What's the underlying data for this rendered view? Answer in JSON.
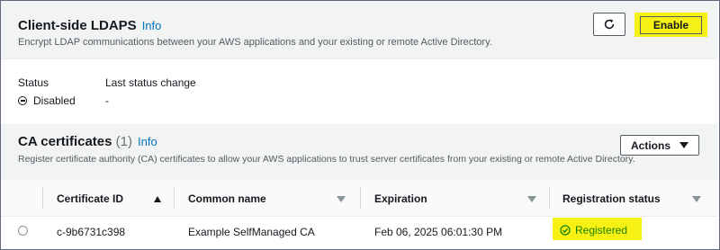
{
  "ldaps": {
    "title": "Client-side LDAPS",
    "info_label": "Info",
    "description": "Encrypt LDAP communications between your AWS applications and your existing or remote Active Directory.",
    "refresh_icon": "refresh-icon",
    "enable_label": "Enable",
    "highlight_color": "#f7f014"
  },
  "status": {
    "status_label": "Status",
    "status_value": "Disabled",
    "status_icon": "disabled-icon",
    "last_change_label": "Last status change",
    "last_change_value": "-"
  },
  "ca": {
    "title": "CA certificates",
    "count": "(1)",
    "info_label": "Info",
    "description": "Register certificate authority (CA) certificates to allow your AWS applications to trust server certificates from your existing or remote Active Directory.",
    "actions_label": "Actions",
    "table": {
      "columns": [
        "Certificate ID",
        "Common name",
        "Expiration",
        "Registration status"
      ],
      "rows": [
        {
          "certificate_id": "c-9b6731c398",
          "common_name": "Example SelfManaged CA",
          "expiration": "Feb 06, 2025 06:01:30 PM",
          "status": "Registered",
          "status_color": "#1d8102"
        }
      ]
    }
  },
  "colors": {
    "link": "#0073bb",
    "panel_bg": "#f2f3f3",
    "success": "#1d8102"
  }
}
